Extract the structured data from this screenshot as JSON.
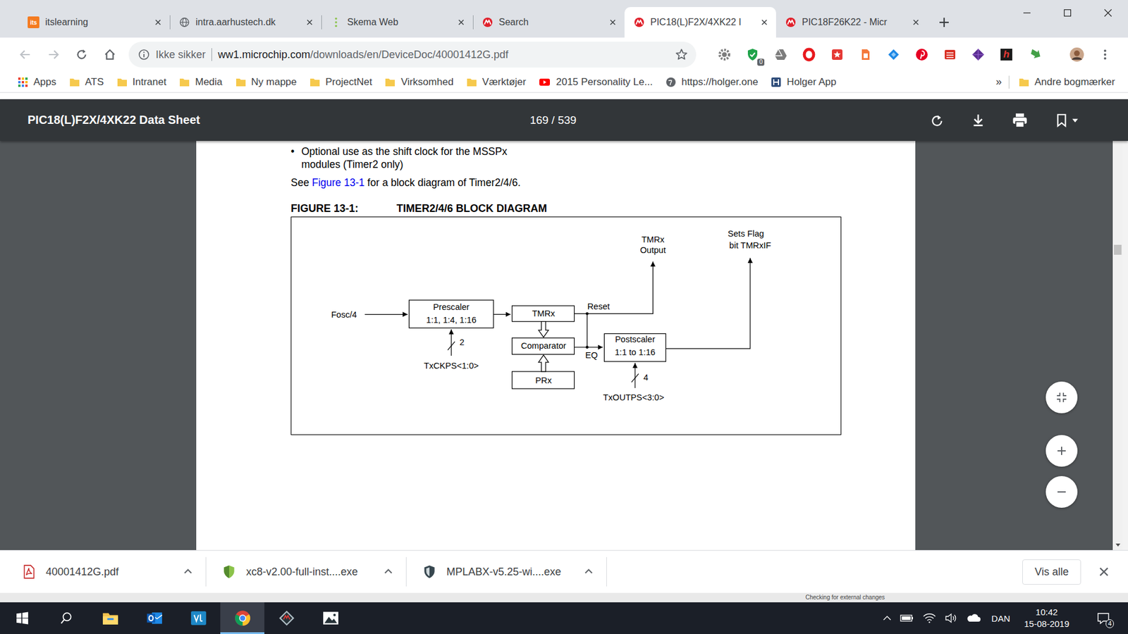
{
  "tabs": [
    {
      "label": "itslearning",
      "kind": "its",
      "icon_text": "its",
      "selected": false
    },
    {
      "label": "intra.aarhustech.dk",
      "kind": "globe",
      "selected": false
    },
    {
      "label": "Skema Web",
      "kind": "dots",
      "selected": false
    },
    {
      "label": "Search",
      "kind": "microchip",
      "selected": false
    },
    {
      "label": "PIC18(L)F2X/4XK22 I",
      "kind": "microchip",
      "selected": true
    },
    {
      "label": "PIC18F26K22 - Micr",
      "kind": "microchip",
      "selected": false
    }
  ],
  "address_bar": {
    "security": "Ikke sikker",
    "host": "ww1.microchip.com",
    "path": "/downloads/en/DeviceDoc/40001412G.pdf"
  },
  "extensions": [
    {
      "kind": "gear",
      "color": "#7d7d7d"
    },
    {
      "kind": "shield",
      "color": "#1fa34a",
      "badge": "0"
    },
    {
      "kind": "drive",
      "color": "#7d7d7d"
    },
    {
      "kind": "ring",
      "color": "#e8191d"
    },
    {
      "kind": "star",
      "color": "#e53935"
    },
    {
      "kind": "doc",
      "color": "#f4793b"
    },
    {
      "kind": "cap",
      "color": "#1e88e5"
    },
    {
      "kind": "pin",
      "color": "#e60023"
    },
    {
      "kind": "stack",
      "color": "#d93025"
    },
    {
      "kind": "diamond",
      "color": "#5b2d91"
    },
    {
      "kind": "letter",
      "color": "#1a1a1a",
      "text": "h"
    },
    {
      "kind": "arrow",
      "color": "#43a047"
    }
  ],
  "bookmarks": {
    "items": [
      {
        "label": "Apps",
        "kind": "apps"
      },
      {
        "label": "ATS",
        "kind": "folder"
      },
      {
        "label": "Intranet",
        "kind": "folder"
      },
      {
        "label": "Media",
        "kind": "folder"
      },
      {
        "label": "Ny mappe",
        "kind": "folder"
      },
      {
        "label": "ProjectNet",
        "kind": "folder"
      },
      {
        "label": "Virksomhed",
        "kind": "folder"
      },
      {
        "label": "Værktøjer",
        "kind": "folder"
      },
      {
        "label": "2015 Personality Le...",
        "kind": "youtube"
      },
      {
        "label": "https://holger.one",
        "kind": "globe"
      },
      {
        "label": "Holger App",
        "kind": "app"
      }
    ],
    "overflow": "»",
    "other": "Andre bogmærker"
  },
  "pdf_viewer": {
    "title": "PIC18(L)F2X/4XK22 Data Sheet",
    "page": "169 / 539",
    "scrollbar": {
      "level": 0.26
    }
  },
  "document": {
    "bullet": "•",
    "bullet_lines": [
      "Optional use as the shift clock for the MSSPx",
      "modules (Timer2 only)"
    ],
    "see": {
      "before": "See ",
      "link": "Figure 13-1",
      "after": " for a block diagram of Timer2/4/6."
    },
    "figure": {
      "number": "FIGURE 13-1:",
      "title": "TIMER2/4/6 BLOCK DIAGRAM"
    }
  },
  "diagram": {
    "input": "Fosc/4",
    "prescaler": [
      "Prescaler",
      "1:1, 1:4, 1:16"
    ],
    "prescaler_select": {
      "bits": "2",
      "label": "TxCKPS<1:0>"
    },
    "timer": "TMRx",
    "comparator": "Comparator",
    "period": "PRx",
    "reset": "Reset",
    "eq": "EQ",
    "output": [
      "TMRx",
      "Output"
    ],
    "postscaler": [
      "Postscaler",
      "1:1 to 1:16"
    ],
    "postscaler_select": {
      "bits": "4",
      "label": "TxOUTPS<3:0>"
    },
    "flag": [
      "Sets Flag",
      "bit TMRxIF"
    ]
  },
  "downloads": {
    "items": [
      {
        "name": "40001412G.pdf",
        "kind": "pdf"
      },
      {
        "name": "xc8-v2.00-full-inst....exe",
        "kind": "shield-green"
      },
      {
        "name": "MPLABX-v5.25-wi....exe",
        "kind": "shield-dark"
      }
    ],
    "show_all": "Vis alle"
  },
  "background_window": {
    "status": "Checking for external changes"
  },
  "taskbar": {
    "apps": [
      {
        "kind": "explorer",
        "active": false
      },
      {
        "kind": "outlook",
        "active": false
      },
      {
        "kind": "code",
        "active": false
      },
      {
        "kind": "chrome",
        "active": true
      },
      {
        "kind": "mplab",
        "active": false
      },
      {
        "kind": "photos",
        "active": false
      }
    ],
    "language": "DAN",
    "time": "10:42",
    "date": "15-08-2019",
    "notifications": "4"
  }
}
